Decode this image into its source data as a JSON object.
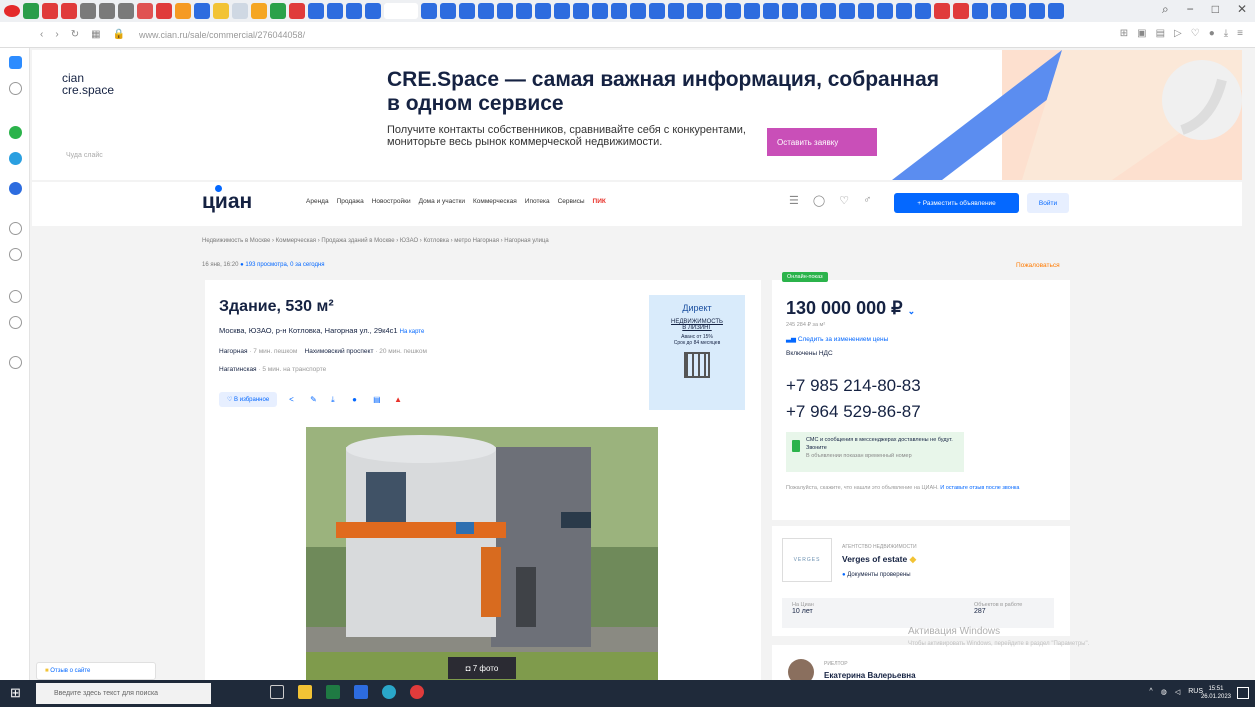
{
  "browser": {
    "url": "www.cian.ru/sale/commercial/276044058/",
    "window_controls": [
      "−",
      "□",
      "✕"
    ],
    "search_icon_label": "⌕"
  },
  "banner": {
    "logo_line1": "cian",
    "logo_line2": "cre.space",
    "small_text": "Чуда слайс",
    "title": "CRE.Space — самая важная информация, собранная в одном сервисе",
    "text": "Получите контакты собственников, сравнивайте себя с конкурентами, мониторьте весь рынок коммерческой недвижимости.",
    "button": "Оставить заявку"
  },
  "header": {
    "logo": "циан",
    "nav": [
      "Аренда",
      "Продажа",
      "Новостройки",
      "Дома и участки",
      "Коммерческая",
      "Ипотека",
      "Сервисы"
    ],
    "nav_brand": "ПИК",
    "post_button": "+ Разместить объявление",
    "login_button": "Войти"
  },
  "breadcrumbs": "Недвижимость в Москве › Коммерческая › Продажа зданий в Москве › ЮЗАО › Котловка › метро Нагорная › Нагорная улица",
  "meta": {
    "date": "16 янв, 16:20",
    "views": "193 просмотра, 0 за сегодня",
    "complain": "Пожаловаться"
  },
  "listing": {
    "title": "Здание, 530 м²",
    "address": "Москва, ЮЗАО, р-н Котловка, Нагорная ул., 29к4с1",
    "map_link": "На карте",
    "metro": [
      {
        "name": "Нагорная",
        "dist": "· 7 мин. пешком"
      },
      {
        "name": "Нахимовский проспект",
        "dist": "· 20 мин. пешком"
      },
      {
        "name": "Нагатинская",
        "dist": "· 5 мин. на транспорте"
      }
    ],
    "favorite": "♡ В избранное",
    "photos_badge": "7 фото"
  },
  "ad": {
    "brand": "Директ",
    "line1": "НЕДВИЖИМОСТЬ",
    "line2": "В ЛИЗИНГ",
    "line3": "Аванс от 15%",
    "line4": "Срок до 84 месяцев"
  },
  "price": {
    "online_badge": "Онлайн-показ",
    "value": "130 000 000 ₽",
    "per_m2": "245 284 ₽ за м²",
    "follow": "Следить за изменением цены",
    "vat": "Включены НДС",
    "phone1": "+7 985 214-80-83",
    "phone2": "+7 964 529-86-87",
    "sms_title": "СМС и сообщения в мессенджерах доставлены не будут. Звоните",
    "sms_sub": "В объявлении показан временный номер",
    "note": "Пожалуйста, скажите, что нашли это объявление на ЦИАН.",
    "note_link": "И оставьте отзыв после звонка"
  },
  "agency": {
    "label": "АГЕНТСТВО НЕДВИЖИМОСТИ",
    "logo_text": "VERGES",
    "name": "Verges of estate",
    "docs": "Документы проверены",
    "stat1_label": "На Циан",
    "stat1_value": "10 лет",
    "stat2_label": "Объектов в работе",
    "stat2_value": "287"
  },
  "contact": {
    "label": "РИЕЛТОР",
    "name": "Екатерина Валерьевна"
  },
  "windows": {
    "activation_title": "Активация Windows",
    "activation_text": "Чтобы активировать Windows, перейдите в раздел \"Параметры\".",
    "search_placeholder": "Введите здесь текст для поиска",
    "tray": "RUS",
    "time": "15:51",
    "date": "26.01.2023"
  },
  "feedback": "Отзыв о сайте"
}
